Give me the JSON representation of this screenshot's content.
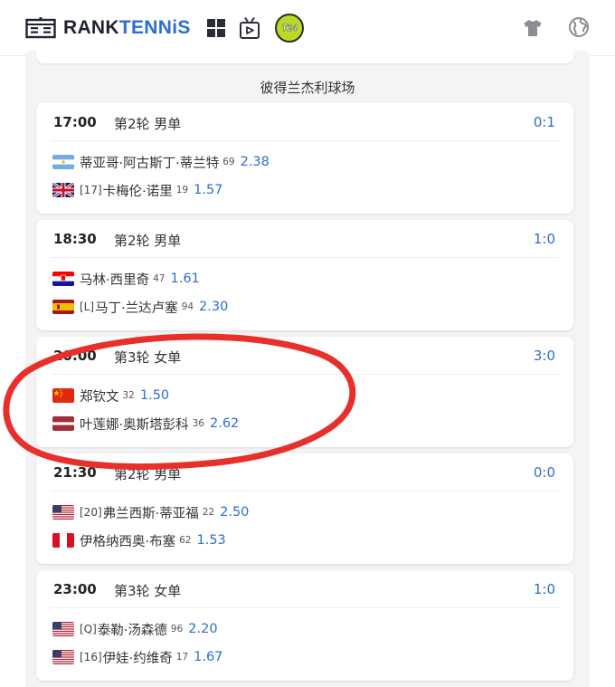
{
  "header": {
    "brand_part1": "RANK",
    "brand_part2": "TENNiS",
    "t24_label": "T24"
  },
  "venue": "彼得兰杰利球场",
  "matches": [
    {
      "time": "17:00",
      "round": "第2轮 男单",
      "score": "0:1",
      "players": [
        {
          "seed": "",
          "name": "蒂亚哥·阿古斯丁·蒂兰特",
          "rank": "69",
          "odds": "2.38",
          "flag": "argentina"
        },
        {
          "seed": "[17]",
          "name": "卡梅伦·诺里",
          "rank": "19",
          "odds": "1.57",
          "flag": "uk"
        }
      ]
    },
    {
      "time": "18:30",
      "round": "第2轮 男单",
      "score": "1:0",
      "players": [
        {
          "seed": "",
          "name": "马林·西里奇",
          "rank": "47",
          "odds": "1.61",
          "flag": "croatia"
        },
        {
          "seed": "[L]",
          "name": "马丁·兰达卢塞",
          "rank": "94",
          "odds": "2.30",
          "flag": "spain"
        }
      ]
    },
    {
      "time": "20:00",
      "round": "第3轮 女单",
      "score": "3:0",
      "players": [
        {
          "seed": "",
          "name": "郑钦文",
          "rank": "32",
          "odds": "1.50",
          "flag": "china"
        },
        {
          "seed": "",
          "name": "叶莲娜·奥斯塔彭科",
          "rank": "36",
          "odds": "2.62",
          "flag": "latvia"
        }
      ]
    },
    {
      "time": "21:30",
      "round": "第2轮 男单",
      "score": "0:0",
      "players": [
        {
          "seed": "[20]",
          "name": "弗兰西斯·蒂亚福",
          "rank": "22",
          "odds": "2.50",
          "flag": "usa"
        },
        {
          "seed": "",
          "name": "伊格纳西奥·布塞",
          "rank": "62",
          "odds": "1.53",
          "flag": "peru"
        }
      ]
    },
    {
      "time": "23:00",
      "round": "第3轮 女单",
      "score": "1:0",
      "players": [
        {
          "seed": "[Q]",
          "name": "泰勒·汤森德",
          "rank": "96",
          "odds": "2.20",
          "flag": "usa"
        },
        {
          "seed": "[16]",
          "name": "伊娃·约维奇",
          "rank": "17",
          "odds": "1.67",
          "flag": "usa"
        }
      ]
    }
  ],
  "colors": {
    "accent_blue": "#2b6fd1",
    "annotation_red": "#e8302b",
    "t24_green": "#b7db27"
  }
}
